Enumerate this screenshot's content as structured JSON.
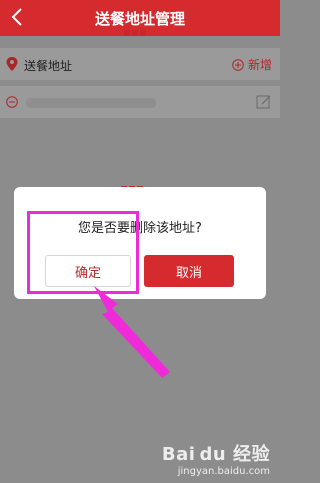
{
  "header": {
    "title": "送餐地址管理"
  },
  "address_bar": {
    "label": "送餐地址",
    "add_label": "新增"
  },
  "dialog": {
    "message": "您是否要删除该地址?",
    "confirm_label": "确定",
    "cancel_label": "取消"
  },
  "watermark": {
    "logo": "Bai du 经验",
    "url": "jingyan.baidu.com"
  },
  "colors": {
    "brand": "#d52a2e",
    "highlight": "#ef2bd9",
    "overlay": "#8c8c8c"
  },
  "icons": [
    "back-icon",
    "location-pin-icon",
    "add-circle-icon",
    "minus-circle-icon",
    "edit-icon"
  ]
}
